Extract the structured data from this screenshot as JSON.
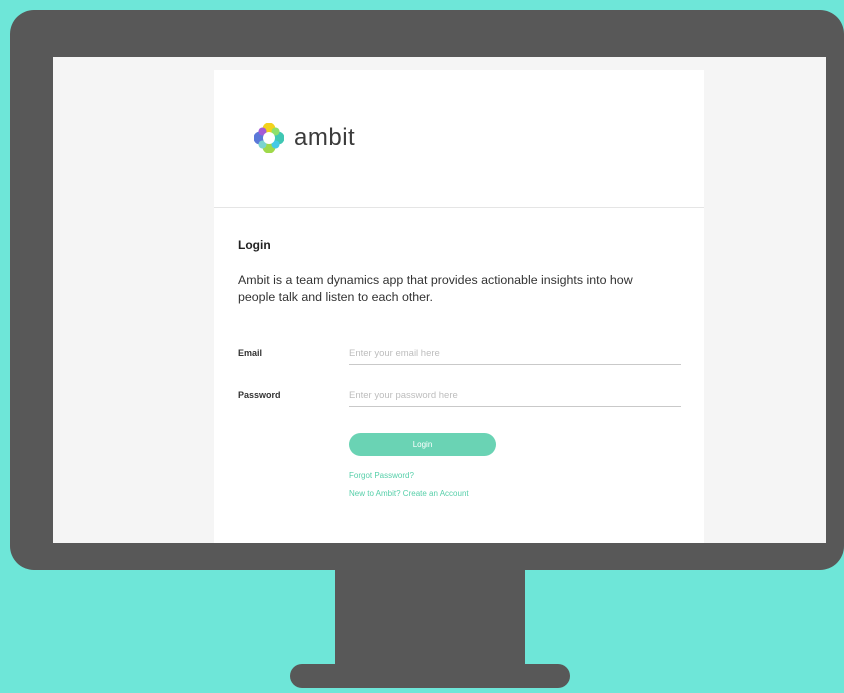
{
  "brand": {
    "name": "ambit"
  },
  "login": {
    "title": "Login",
    "description": "Ambit is a team dynamics app that provides actionable insights into how people talk and listen to each other.",
    "email_label": "Email",
    "email_placeholder": "Enter your email here",
    "email_value": "",
    "password_label": "Password",
    "password_placeholder": "Enter your password here",
    "password_value": "",
    "button_label": "Login",
    "forgot_link": "Forgot Password?",
    "create_link": "New to Ambit? Create an Account"
  },
  "colors": {
    "background": "#6ee6d8",
    "monitor": "#585858",
    "accent": "#6ad3b4",
    "link": "#56cfa9"
  }
}
